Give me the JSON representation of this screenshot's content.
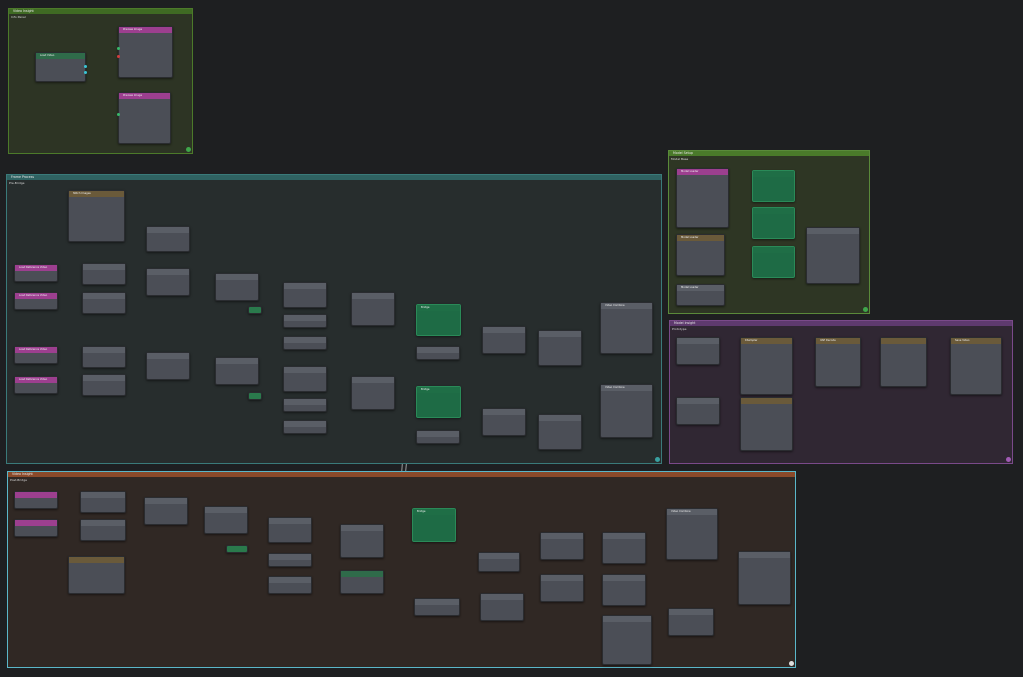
{
  "groups": {
    "top_left": {
      "header": "Video Insight",
      "sub": "Info Panel"
    },
    "middle_left": {
      "header": "Frame Process",
      "sub": "Pre-Bridge"
    },
    "top_right": {
      "header": "Model Setup",
      "sub": "Model Base"
    },
    "right_mid": {
      "header": "Model Insight",
      "sub": "Prototype"
    },
    "bottom": {
      "header": "Video Insight",
      "sub": "Post-Bridge"
    }
  },
  "nodes": {
    "load_video_1": "Load Video",
    "preview_1": "Preview Image",
    "preview_2": "Preview Image",
    "stitch_1": "Stitch Images",
    "pink_1": "Load Reference Video",
    "pink_2": "Load Reference Video",
    "pink_3": "Load Reference Video",
    "pink_4": "Load Reference Video",
    "bridge_1": "Bridge",
    "bridge_2": "Bridge",
    "bridge_3": "Bridge",
    "video_combine_1": "Video Combine",
    "video_combine_2": "Video Combine",
    "video_combine_3": "Video Combine",
    "model_1": "Model Loader",
    "model_2": "Model Loader",
    "model_3": "Model Loader",
    "sampler": "KSampler",
    "decode": "VAE Decode",
    "save": "Save Video"
  },
  "colors": {
    "top_left_border": "#4c7a2a",
    "middle_border": "#3a7a7a",
    "top_right_border": "#5a8a3a",
    "right_mid_border": "#7a4a8a",
    "bottom_border": "#5ab7c9"
  }
}
